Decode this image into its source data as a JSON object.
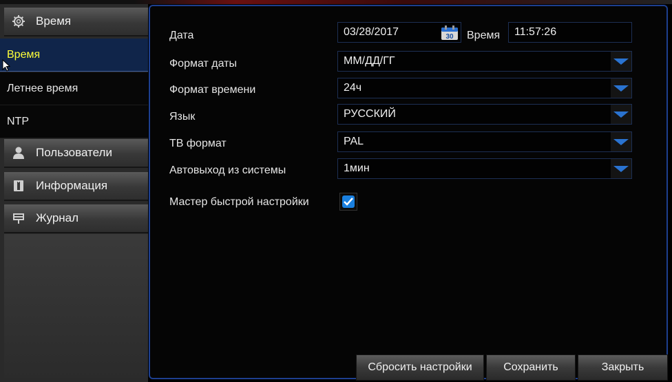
{
  "sidebar": {
    "category_time": {
      "label": "Время",
      "icon": "gear-icon"
    },
    "items": [
      {
        "label": "Время",
        "active": true
      },
      {
        "label": "Летнее время",
        "active": false
      },
      {
        "label": "NTP",
        "active": false
      }
    ],
    "category_users": {
      "label": "Пользователи",
      "icon": "user-icon"
    },
    "category_info": {
      "label": "Информация",
      "icon": "info-book-icon"
    },
    "category_log": {
      "label": "Журнал",
      "icon": "log-icon"
    }
  },
  "form": {
    "date_label": "Дата",
    "date_value": "03/28/2017",
    "calendar_icon_text": "30",
    "time_label": "Время",
    "time_value": "11:57:26",
    "date_format_label": "Формат даты",
    "date_format_value": "ММ/ДД/ГГ",
    "time_format_label": "Формат времени",
    "time_format_value": "24ч",
    "language_label": "Язык",
    "language_value": "РУССКИЙ",
    "tv_format_label": "ТВ формат",
    "tv_format_value": "PAL",
    "auto_logout_label": "Автовыход из системы",
    "auto_logout_value": "1мин",
    "wizard_label": "Мастер быстрой настройки",
    "wizard_checked": true
  },
  "buttons": {
    "reset": "Сбросить настройки",
    "save": "Сохранить",
    "close": "Закрыть"
  },
  "colors": {
    "accent_blue": "#1d3f8f",
    "active_text": "#ffff3a",
    "dropdown_arrow": "#2a73d0"
  }
}
